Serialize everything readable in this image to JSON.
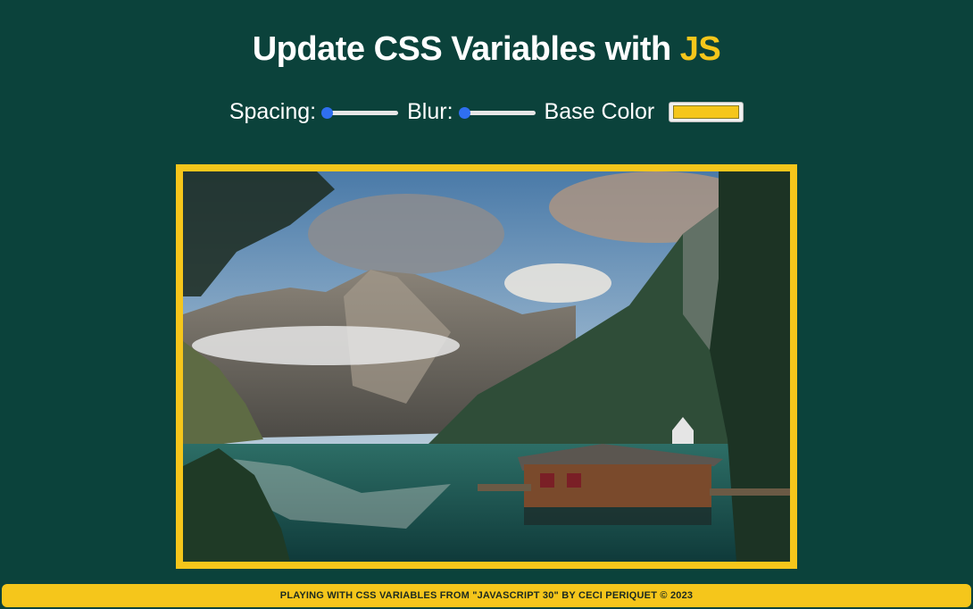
{
  "header": {
    "title_main": "Update CSS Variables with",
    "title_highlight": "JS"
  },
  "controls": {
    "spacing_label": "Spacing:",
    "spacing_value": 0,
    "blur_label": "Blur:",
    "blur_value": 0,
    "color_label": "Base Color",
    "color_value": "#f5c61b"
  },
  "image": {
    "alt_icon": "mountain-lake-photo"
  },
  "footer": {
    "text": "PLAYING WITH CSS VARIABLES FROM \"JAVASCRIPT 30\" BY CECI PERIQUET © 2023"
  },
  "colors": {
    "background": "#0b423b",
    "accent": "#f5c61b",
    "slider_thumb": "#2f6ff0"
  }
}
